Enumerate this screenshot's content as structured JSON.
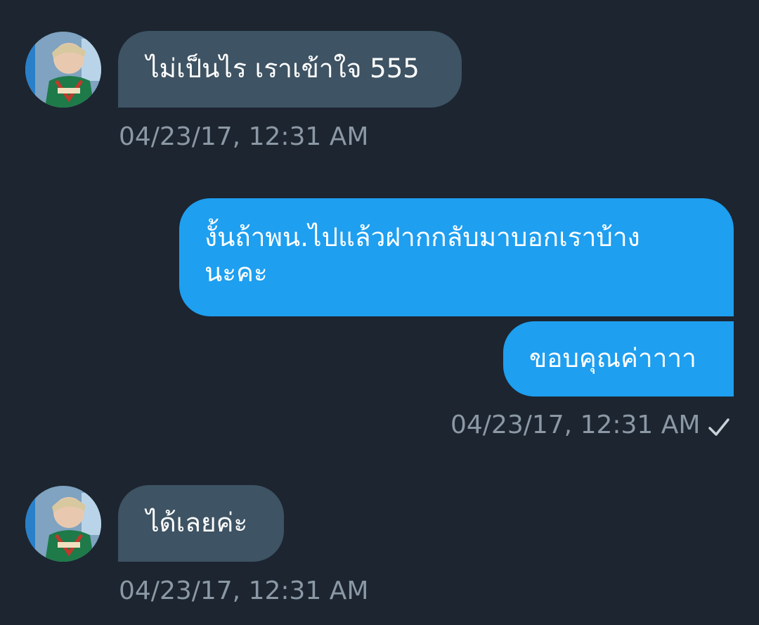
{
  "conversation": {
    "messages": [
      {
        "direction": "incoming",
        "text": "ไม่เป็นไร เราเข้าใจ 555",
        "timestamp": "04/23/17, 12:31 AM"
      },
      {
        "direction": "outgoing",
        "text_line1": "งั้นถ้าพน.ไปแล้วฝากกลับมาบอกเราบ้าง",
        "text_line2": "นะคะ"
      },
      {
        "direction": "outgoing",
        "text": "ขอบคุณค่าาาา",
        "timestamp": "04/23/17, 12:31 AM",
        "status": "check-icon"
      },
      {
        "direction": "incoming",
        "text": "ได้เลยค่ะ",
        "timestamp": "04/23/17, 12:31 AM"
      }
    ]
  },
  "colors": {
    "background": "#1c2530",
    "incoming_bubble": "#3e5363",
    "outgoing_bubble": "#1e9ff0",
    "timestamp_text": "#8b98a5",
    "message_text": "#ffffff"
  }
}
